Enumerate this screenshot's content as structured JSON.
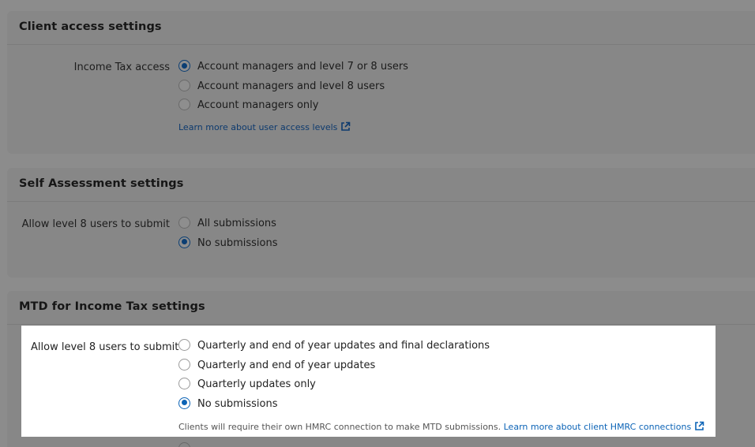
{
  "sections": {
    "client_access": {
      "title": "Client access settings",
      "label": "Income Tax access",
      "options": [
        "Account managers and level 7 or 8 users",
        "Account managers and level 8 users",
        "Account managers only"
      ],
      "selected_index": 0,
      "link": "Learn more about user access levels"
    },
    "self_assessment": {
      "title": "Self Assessment settings",
      "label": "Allow level 8 users to submit",
      "options": [
        "All submissions",
        "No submissions"
      ],
      "selected_index": 1
    },
    "mtd": {
      "title": "MTD for Income Tax settings",
      "label": "Allow level 8 users to submit",
      "options": [
        "Quarterly and end of year updates and final declarations",
        "Quarterly and end of year updates",
        "Quarterly updates only",
        "No submissions"
      ],
      "selected_index": 3,
      "help_text": "Clients will require their own HMRC connection to make MTD submissions.",
      "link": "Learn more about client HMRC connections"
    }
  },
  "icons": {
    "external_link": "external-link-icon",
    "radio": "radio-icon"
  },
  "colors": {
    "overlay_dim": "#878787",
    "link_blue": "#0b63b6",
    "radio_selected": "#0b63b6",
    "highlight_bg": "#ffffff"
  }
}
